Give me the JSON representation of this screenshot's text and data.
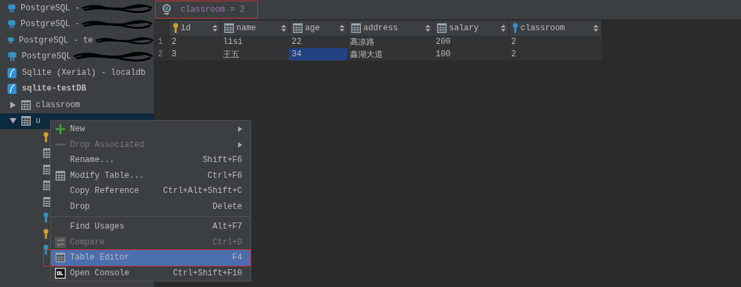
{
  "sidebar": {
    "items": [
      {
        "kind": "postgres",
        "label": "PostgreSQL -"
      },
      {
        "kind": "postgres",
        "label": "PostgreSQL -"
      },
      {
        "kind": "postgres",
        "label": "PostgreSQL - te"
      },
      {
        "kind": "postgres",
        "label": "PostgreSQL"
      },
      {
        "kind": "sqlite",
        "label": "Sqlite (Xerial) - localdb",
        "bold": false
      },
      {
        "kind": "sqlite",
        "label": "sqlite-testDB",
        "bold": true,
        "children": [
          {
            "kind": "table",
            "label": "classroom",
            "expanded": false,
            "selected": false
          },
          {
            "kind": "table",
            "label": "u",
            "expanded": true,
            "selected": true
          }
        ]
      }
    ]
  },
  "filter": {
    "text": "classroom = 2",
    "annotated": true
  },
  "table": {
    "columns": [
      {
        "label": "id",
        "kind": "primary_key"
      },
      {
        "label": "name",
        "kind": "column"
      },
      {
        "label": "age",
        "kind": "column"
      },
      {
        "label": "address",
        "kind": "column"
      },
      {
        "label": "salary",
        "kind": "column"
      },
      {
        "label": "classroom",
        "kind": "foreign_key"
      }
    ],
    "rows": [
      {
        "number": "1",
        "cells": [
          {
            "text": "2",
            "selected": false
          },
          {
            "text": "lisi",
            "selected": false
          },
          {
            "text": "22",
            "selected": false
          },
          {
            "text": "高凉路",
            "selected": false
          },
          {
            "text": "200",
            "selected": false
          },
          {
            "text": "2",
            "selected": false
          }
        ]
      },
      {
        "number": "2",
        "cells": [
          {
            "text": "3",
            "selected": false
          },
          {
            "text": "王五",
            "selected": false
          },
          {
            "text": "34",
            "selected": true
          },
          {
            "text": "鑫湖大道",
            "selected": false
          },
          {
            "text": "100",
            "selected": false
          },
          {
            "text": "2",
            "selected": false
          }
        ]
      }
    ]
  },
  "context_menu": {
    "items": [
      {
        "kind": "item",
        "label": "New",
        "submenu": true,
        "disabled": false,
        "selected": false
      },
      {
        "kind": "item",
        "label": "Drop Associated",
        "submenu": true,
        "disabled": true,
        "selected": false
      },
      {
        "kind": "item",
        "label": "Rename...",
        "shortcut": "Shift+F6",
        "submenu": false,
        "disabled": false,
        "selected": false
      },
      {
        "kind": "item",
        "label": "Modify Table...",
        "shortcut": "Ctrl+F6",
        "submenu": false,
        "disabled": false,
        "selected": false
      },
      {
        "kind": "item",
        "label": "Copy Reference",
        "shortcut": "Ctrl+Alt+Shift+C",
        "submenu": false,
        "disabled": false,
        "selected": false
      },
      {
        "kind": "item",
        "label": "Drop",
        "shortcut": "Delete",
        "submenu": false,
        "disabled": false,
        "selected": false
      },
      {
        "kind": "separator"
      },
      {
        "kind": "item",
        "label": "Find Usages",
        "shortcut": "Alt+F7",
        "submenu": false,
        "disabled": false,
        "selected": false
      },
      {
        "kind": "item",
        "label": "Compare",
        "shortcut": "Ctrl+D",
        "submenu": false,
        "disabled": true,
        "selected": false
      },
      {
        "kind": "item",
        "label": "Table Editor",
        "shortcut": "F4",
        "submenu": false,
        "disabled": false,
        "selected": true,
        "annotated": true
      },
      {
        "kind": "item",
        "label": "Open Console",
        "shortcut": "Ctrl+Shift+F10",
        "submenu": false,
        "disabled": false,
        "selected": false
      }
    ]
  }
}
